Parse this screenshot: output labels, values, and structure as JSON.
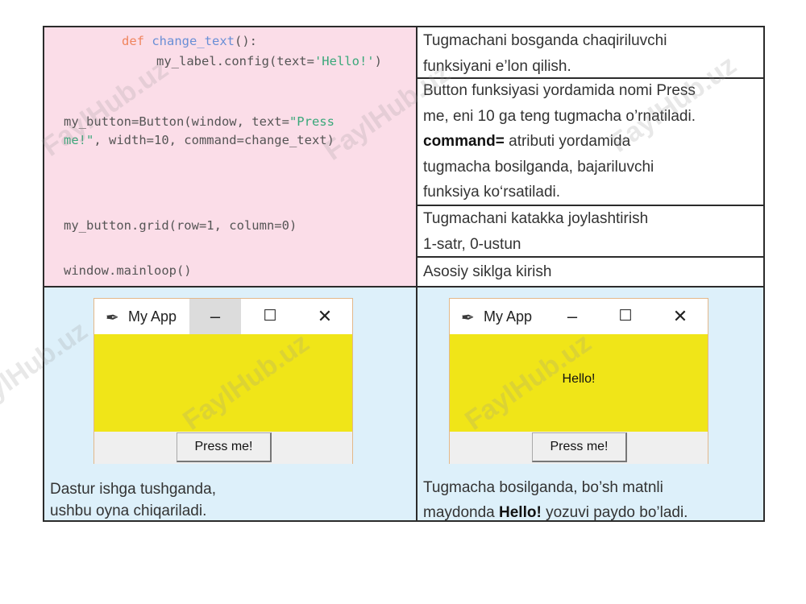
{
  "code": {
    "line1_def": "def",
    "line1_fn": "change_text",
    "line1_rest": "():",
    "line2_pre": "my_label.config(text=",
    "line2_str": "'Hello!'",
    "line2_post": ")",
    "line3_pre": "my_button=Button(window, text=",
    "line3_str": "\"Press",
    "line4_str": "me!\"",
    "line4_post": ", width=10, command=change_text)",
    "line5": "my_button.grid(row=1, column=0)",
    "line6": "window.mainloop()"
  },
  "descriptions": {
    "d1_line1": "Tugmachani bosganda chaqiriluvchi",
    "d1_line2": "funksiyani e’lon qilish.",
    "d2_line1": "Button funksiyasi yordamida nomi Press",
    "d2_line2": "me, eni 10 ga teng tugmacha o’rnatiladi.",
    "d2_bold": "command=",
    "d2_line3_rest": " atributi yordamida",
    "d2_line4": "tugmacha bosilganda, bajariluvchi",
    "d2_line5": "funksiya ko‘rsatiladi.",
    "d3_line1": "Tugmachani katakka joylashtirish",
    "d3_line2": "1-satr, 0-ustun",
    "d4_line1": "Asosiy siklga kirish"
  },
  "window_left": {
    "title": "My App",
    "minimize": "–",
    "maximize": "☐",
    "close": "✕",
    "button_label": "Press me!"
  },
  "window_right": {
    "title": "My App",
    "minimize": "–",
    "maximize": "☐",
    "close": "✕",
    "body_text": "Hello!",
    "button_label": "Press me!"
  },
  "captions": {
    "left_line1": "Dastur ishga tushganda,",
    "left_line2": "ushbu oyna chiqariladi.",
    "right_line1": "Tugmacha bosilganda, bo’sh matnli",
    "right_line2_pre": "maydonda ",
    "right_line2_bold": "Hello!",
    "right_line2_post": " yozuvi paydo bo’ladi."
  },
  "watermark": "FaylHub.uz",
  "colors": {
    "code_bg": "#fbdde8",
    "screenshot_bg": "#ddf0fa",
    "window_body": "#f0e518",
    "border": "#2b2b2b"
  }
}
